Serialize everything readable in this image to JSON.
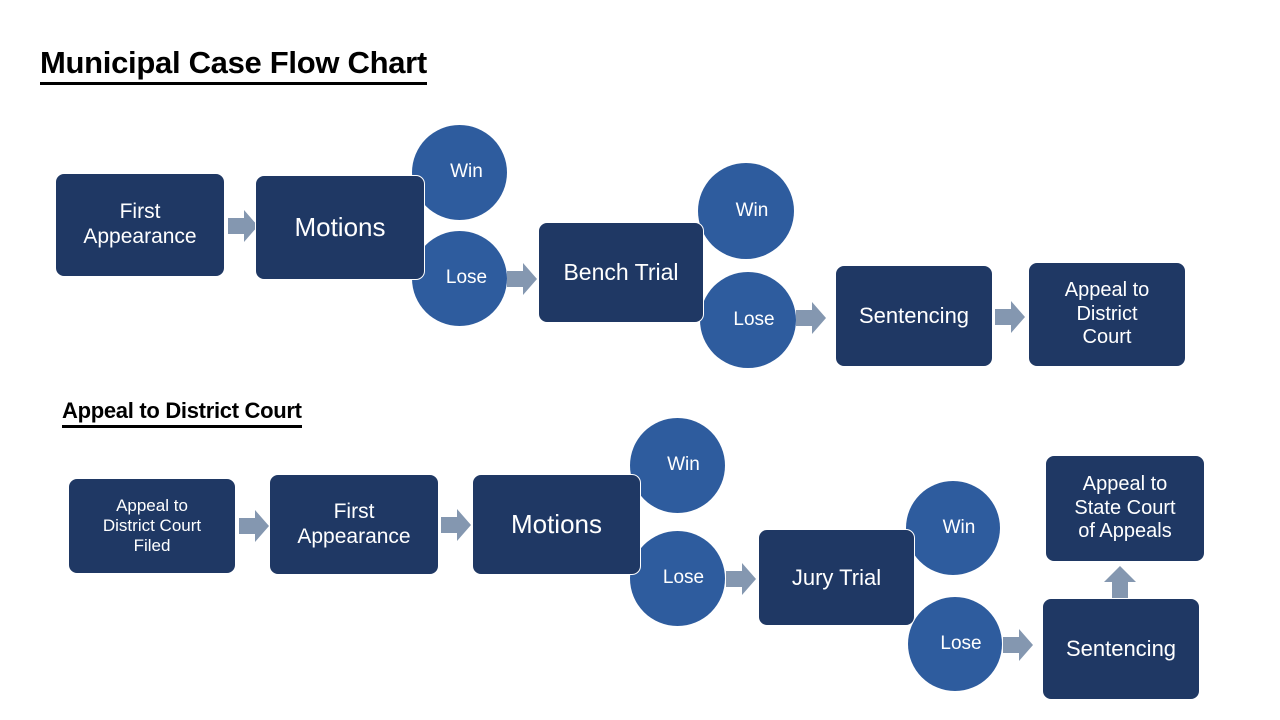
{
  "document": {
    "title": "Municipal Case Flow Chart",
    "section_heading": "Appeal to District Court"
  },
  "colors": {
    "box_fill": "#1F3864",
    "circle_fill": "#2E5C9E",
    "arrow_fill": "#8497B0",
    "text_on_shape": "#FFFFFF",
    "heading_text": "#000000",
    "background": "#FFFFFF"
  },
  "flow_municipal": {
    "nodes": [
      {
        "id": "m-first-appearance",
        "label": "First\nAppearance",
        "shape": "rounded-rect"
      },
      {
        "id": "m-motions",
        "label": "Motions",
        "shape": "rounded-rect"
      },
      {
        "id": "m-motions-win",
        "label": "Win",
        "shape": "circle"
      },
      {
        "id": "m-motions-lose",
        "label": "Lose",
        "shape": "circle"
      },
      {
        "id": "m-bench-trial",
        "label": "Bench Trial",
        "shape": "rounded-rect"
      },
      {
        "id": "m-bench-win",
        "label": "Win",
        "shape": "circle"
      },
      {
        "id": "m-bench-lose",
        "label": "Lose",
        "shape": "circle"
      },
      {
        "id": "m-sentencing",
        "label": "Sentencing",
        "shape": "rounded-rect"
      },
      {
        "id": "m-appeal-district",
        "label": "Appeal to\nDistrict\nCourt",
        "shape": "rounded-rect"
      }
    ],
    "edges": [
      {
        "from": "m-first-appearance",
        "to": "m-motions",
        "direction": "right"
      },
      {
        "from": "m-motions-lose",
        "to": "m-bench-trial",
        "direction": "right"
      },
      {
        "from": "m-bench-lose",
        "to": "m-sentencing",
        "direction": "right"
      },
      {
        "from": "m-sentencing",
        "to": "m-appeal-district",
        "direction": "right"
      }
    ]
  },
  "flow_appeal": {
    "nodes": [
      {
        "id": "a-appeal-filed",
        "label": "Appeal to\nDistrict Court\nFiled",
        "shape": "rounded-rect"
      },
      {
        "id": "a-first-appearance",
        "label": "First\nAppearance",
        "shape": "rounded-rect"
      },
      {
        "id": "a-motions",
        "label": "Motions",
        "shape": "rounded-rect"
      },
      {
        "id": "a-motions-win",
        "label": "Win",
        "shape": "circle"
      },
      {
        "id": "a-motions-lose",
        "label": "Lose",
        "shape": "circle"
      },
      {
        "id": "a-jury-trial",
        "label": "Jury Trial",
        "shape": "rounded-rect"
      },
      {
        "id": "a-jury-win",
        "label": "Win",
        "shape": "circle"
      },
      {
        "id": "a-jury-lose",
        "label": "Lose",
        "shape": "circle"
      },
      {
        "id": "a-sentencing",
        "label": "Sentencing",
        "shape": "rounded-rect"
      },
      {
        "id": "a-appeal-state",
        "label": "Appeal to\nState Court\nof Appeals",
        "shape": "rounded-rect"
      }
    ],
    "edges": [
      {
        "from": "a-appeal-filed",
        "to": "a-first-appearance",
        "direction": "right"
      },
      {
        "from": "a-first-appearance",
        "to": "a-motions",
        "direction": "right"
      },
      {
        "from": "a-motions-lose",
        "to": "a-jury-trial",
        "direction": "right"
      },
      {
        "from": "a-jury-lose",
        "to": "a-sentencing",
        "direction": "right"
      },
      {
        "from": "a-sentencing",
        "to": "a-appeal-state",
        "direction": "up"
      }
    ]
  }
}
